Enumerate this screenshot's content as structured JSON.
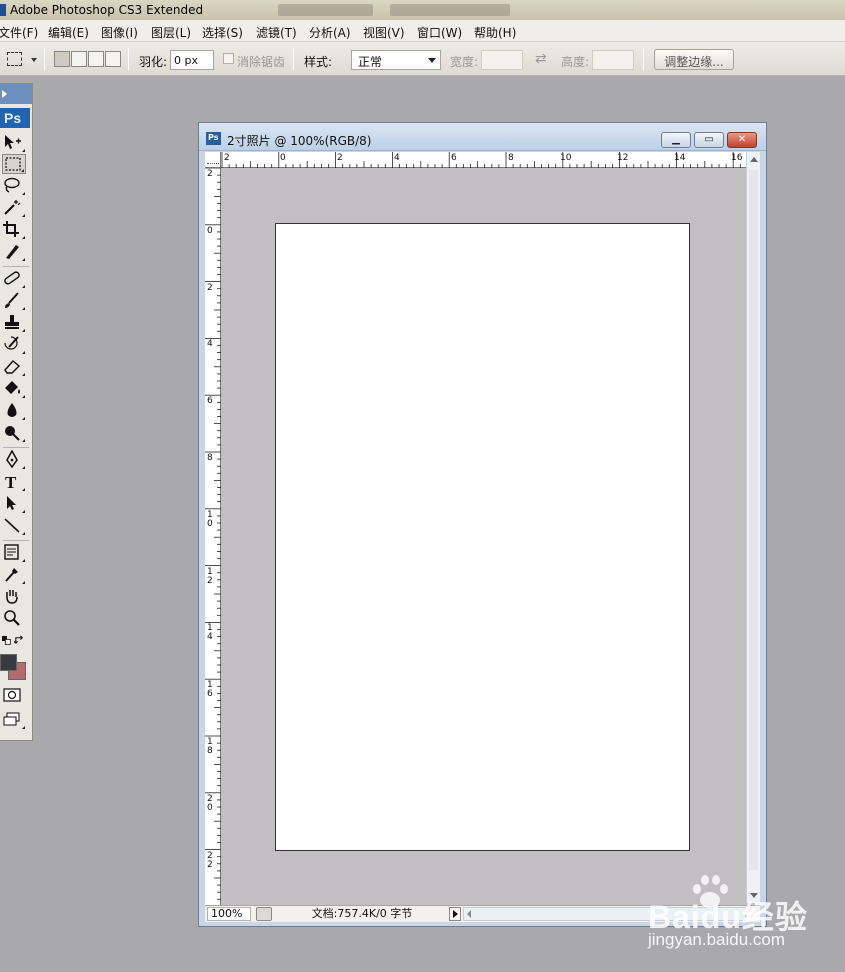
{
  "app": {
    "title": "Adobe Photoshop CS3 Extended"
  },
  "menu": {
    "items": [
      "文件(F)",
      "编辑(E)",
      "图像(I)",
      "图层(L)",
      "选择(S)",
      "滤镜(T)",
      "分析(A)",
      "视图(V)",
      "窗口(W)",
      "帮助(H)"
    ]
  },
  "options": {
    "feather_label": "羽化:",
    "feather_value": "0 px",
    "antialias_label": "消除锯齿",
    "style_label": "样式:",
    "style_value": "正常",
    "width_label": "宽度:",
    "width_value": "",
    "height_label": "高度:",
    "height_value": "",
    "refine_edge_label": "调整边缘..."
  },
  "toolbox": {
    "logo": "Ps",
    "foreground_color": "#353b3e",
    "background_color": "#b56a6d"
  },
  "document": {
    "title": "2寸照片 @ 100%(RGB/8)",
    "ruler_top_labels": [
      "2",
      "0",
      "2",
      "4",
      "6",
      "8",
      "10",
      "12",
      "14",
      "16"
    ],
    "ruler_left_labels": [
      "2",
      "0",
      "2",
      "4",
      "6",
      "8",
      "1 0",
      "1 2",
      "1 4",
      "1 6",
      "1 8",
      "2 0",
      "2 2"
    ],
    "zoom": "100%",
    "status": "文档:757.4K/0 字节"
  },
  "watermark": {
    "logo": "Baidu经验",
    "url": "jingyan.baidu.com"
  }
}
